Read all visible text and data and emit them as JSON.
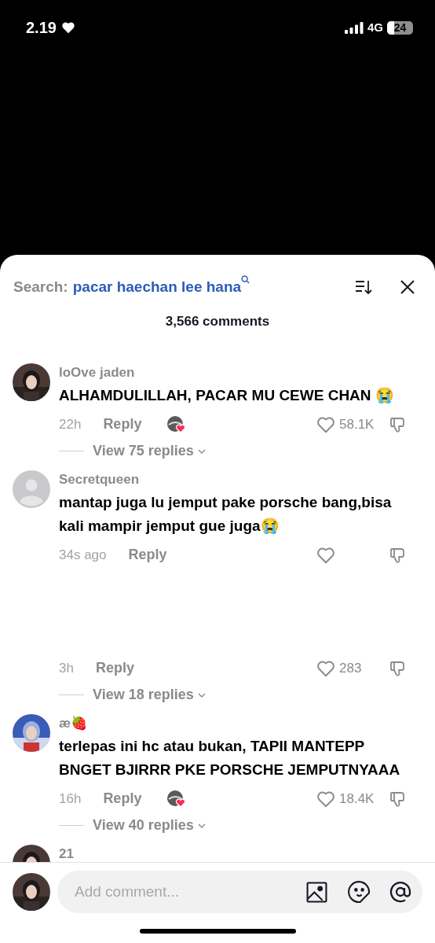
{
  "status_bar": {
    "time": "2.19",
    "network": "4G",
    "battery": "24"
  },
  "header": {
    "search_label": "Search:",
    "search_query": "pacar haechan lee hana",
    "comment_count": "3,566 comments"
  },
  "comments": [
    {
      "name": "loOve jaden",
      "text": "ALHAMDULILLAH, PACAR MU CEWE CHAN 😭",
      "time": "22h",
      "reply": "Reply",
      "creator_liked": true,
      "likes": "58.1K",
      "view_replies": "View 75 replies"
    },
    {
      "kind": "default",
      "name": "Secretqueen",
      "text": "mantap juga lu jemput pake porsche bang,bisa kali mampir jemput gue juga😭",
      "time": "34s ago",
      "reply": "Reply",
      "creator_liked": false
    },
    {
      "kind": "bare",
      "time": "3h",
      "reply": "Reply",
      "creator_liked": false,
      "likes": "283",
      "view_replies": "View 18 replies"
    },
    {
      "name": "æ🍓",
      "text": "terlepas ini hc atau bukan, TAPII MANTEPP BNGET BJIRRR PKE PORSCHE JEMPUTNYAAA",
      "time": "16h",
      "reply": "Reply",
      "creator_liked": true,
      "likes": "18.4K",
      "view_replies": "View 40 replies"
    },
    {
      "name": "21"
    }
  ],
  "composer": {
    "placeholder": "Add comment..."
  }
}
